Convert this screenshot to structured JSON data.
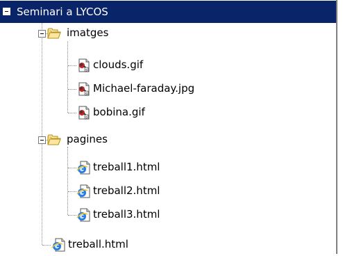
{
  "tree": {
    "root": {
      "label": "Seminari a LYCOS",
      "icon": "collapse-minus-icon"
    },
    "folders": [
      {
        "label": "imatges",
        "icon": "folder-open-icon",
        "expander": "collapse-minus-icon",
        "files": [
          {
            "label": "clouds.gif",
            "icon": "image-file-icon"
          },
          {
            "label": "Michael-faraday.jpg",
            "icon": "image-file-icon"
          },
          {
            "label": "bobina.gif",
            "icon": "image-file-icon"
          }
        ]
      },
      {
        "label": "pagines",
        "icon": "folder-open-icon",
        "expander": "collapse-minus-icon",
        "files": [
          {
            "label": "treball1.html",
            "icon": "html-file-icon"
          },
          {
            "label": "treball2.html",
            "icon": "html-file-icon"
          },
          {
            "label": "treball3.html",
            "icon": "html-file-icon"
          }
        ]
      }
    ],
    "files": [
      {
        "label": "treball.html",
        "icon": "html-file-icon"
      }
    ]
  }
}
